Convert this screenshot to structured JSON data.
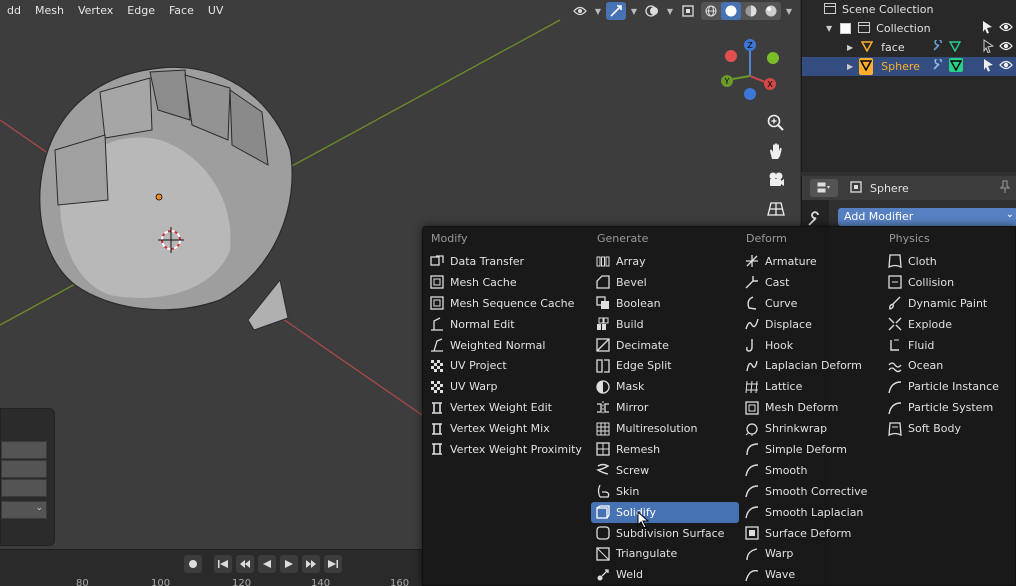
{
  "viewport_menu": [
    "dd",
    "Mesh",
    "Vertex",
    "Edge",
    "Face",
    "UV"
  ],
  "gizmo_axes": {
    "z": "Z",
    "y": "Y",
    "x": "X"
  },
  "timeline_frames": [
    "80",
    "100",
    "120",
    "140",
    "160"
  ],
  "outliner": {
    "scene_collection": "Scene Collection",
    "collection": "Collection",
    "items": [
      {
        "label": "face",
        "selected": false
      },
      {
        "label": "Sphere",
        "selected": true
      }
    ]
  },
  "properties": {
    "object_name": "Sphere",
    "add_modifier": "Add Modifier"
  },
  "add_modifier_menu": {
    "columns": [
      {
        "heading": "Modify",
        "items": [
          "Data Transfer",
          "Mesh Cache",
          "Mesh Sequence Cache",
          "Normal Edit",
          "Weighted Normal",
          "UV Project",
          "UV Warp",
          "Vertex Weight Edit",
          "Vertex Weight Mix",
          "Vertex Weight Proximity"
        ]
      },
      {
        "heading": "Generate",
        "items": [
          "Array",
          "Bevel",
          "Boolean",
          "Build",
          "Decimate",
          "Edge Split",
          "Mask",
          "Mirror",
          "Multiresolution",
          "Remesh",
          "Screw",
          "Skin",
          "Solidify",
          "Subdivision Surface",
          "Triangulate",
          "Weld"
        ]
      },
      {
        "heading": "Deform",
        "items": [
          "Armature",
          "Cast",
          "Curve",
          "Displace",
          "Hook",
          "Laplacian Deform",
          "Lattice",
          "Mesh Deform",
          "Shrinkwrap",
          "Simple Deform",
          "Smooth",
          "Smooth Corrective",
          "Smooth Laplacian",
          "Surface Deform",
          "Warp",
          "Wave"
        ]
      },
      {
        "heading": "Physics",
        "items": [
          "Cloth",
          "Collision",
          "Dynamic Paint",
          "Explode",
          "Fluid",
          "Ocean",
          "Particle Instance",
          "Particle System",
          "Soft Body"
        ]
      }
    ],
    "highlighted": "Solidify"
  },
  "colors": {
    "accent": "#4772b3",
    "selected_row": "#334d80",
    "menu_bg": "#181818",
    "object_orange": "#ffaf29"
  }
}
